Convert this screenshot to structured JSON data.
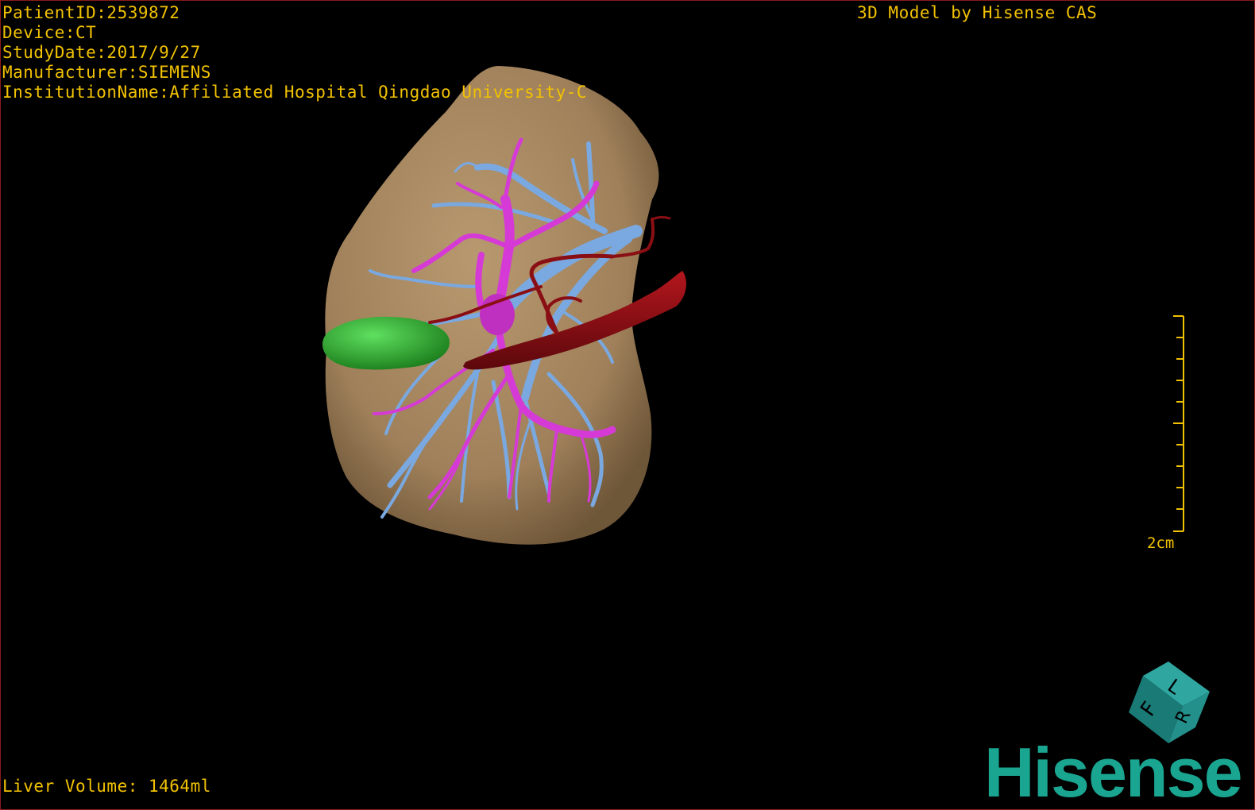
{
  "overlay": {
    "patient_id": "PatientID:2539872",
    "device": "Device:CT",
    "study_date": "StudyDate:2017/9/27",
    "manufacturer": "Manufacturer:SIEMENS",
    "institution": "InstitutionName:Affiliated Hospital Qingdao University-C",
    "brand_title": "3D Model by Hisense CAS",
    "liver_volume": "Liver Volume: 1464ml"
  },
  "scale_bar": {
    "label": "2cm"
  },
  "orientation_cube": {
    "faces": [
      "F",
      "L",
      "R"
    ]
  },
  "logo": {
    "text": "Hisense"
  },
  "colors": {
    "overlay_text": "#f2c200",
    "liver": "#a5865f",
    "hepatic_vein": "#7aa8e0",
    "portal_vein": "#d63ad6",
    "artery": "#8a0f14",
    "gallbladder": "#2aa82a",
    "logo": "#1aa591",
    "border": "#8b1a1a"
  }
}
